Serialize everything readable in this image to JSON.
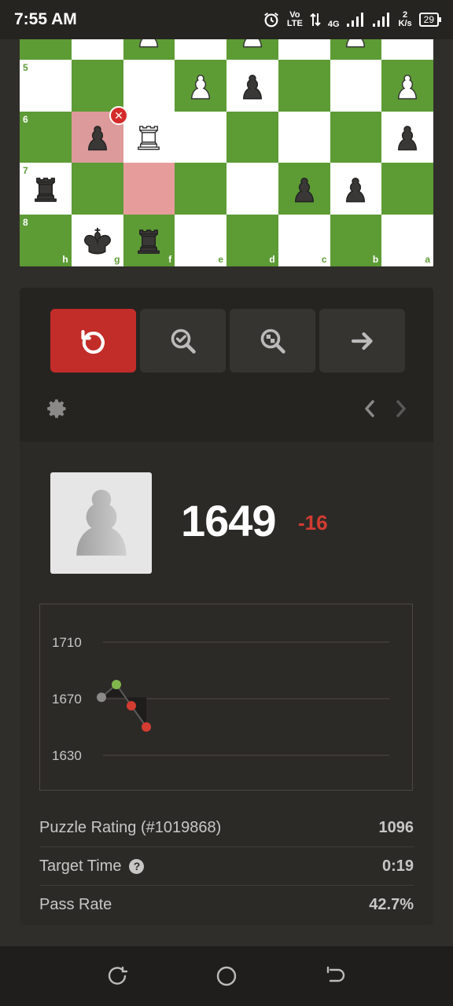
{
  "status_bar": {
    "time": "7:55 AM",
    "network": "4G",
    "speed_value": "2",
    "speed_unit": "K/s",
    "battery": "29",
    "volte_line1": "Vo",
    "volte_line2": "LTE"
  },
  "board": {
    "ranks": [
      "5",
      "6",
      "7",
      "8"
    ],
    "files": [
      "h",
      "g",
      "f",
      "e",
      "d",
      "c",
      "b",
      "a"
    ],
    "wrong_move_marker": "✕",
    "colors": {
      "light": "#ffffff",
      "dark": "#5d9b35",
      "highlight": "#e39a9a"
    }
  },
  "controls": {
    "retry_icon": "retry-icon",
    "analysis_icon": "analysis-icon",
    "hint_icon": "hint-icon",
    "next_icon": "arrow-right-icon",
    "settings_icon": "gear-icon",
    "accent": "#c22c29"
  },
  "rating": {
    "value": "1649",
    "delta": "-16",
    "delta_color": "#d23c31"
  },
  "chart_data": {
    "type": "line",
    "y_ticks": [
      "1710",
      "1670",
      "1630"
    ],
    "ylim": [
      1630,
      1710
    ],
    "points": [
      {
        "x": 0,
        "y": 1671,
        "color": "#8c8a88"
      },
      {
        "x": 1,
        "y": 1680,
        "color": "#81b64c"
      },
      {
        "x": 2,
        "y": 1665,
        "color": "#d23c31"
      },
      {
        "x": 3,
        "y": 1650,
        "color": "#d23c31"
      }
    ]
  },
  "stats": [
    {
      "label": "Puzzle Rating (#1019868)",
      "value": "1096",
      "help": false
    },
    {
      "label": "Target Time",
      "value": "0:19",
      "help": true
    },
    {
      "label": "Pass Rate",
      "value": "42.7%",
      "help": false
    }
  ],
  "help_glyph": "?"
}
